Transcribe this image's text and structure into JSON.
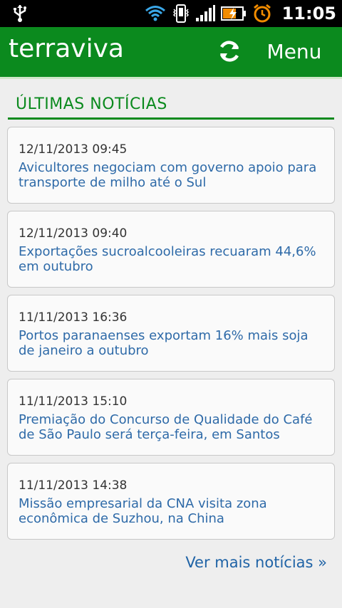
{
  "status_bar": {
    "time": "11:05",
    "icons": [
      "usb-icon",
      "wifi-icon",
      "vibrate-icon",
      "signal-icon",
      "battery-charging-icon",
      "alarm-icon"
    ]
  },
  "app_bar": {
    "logo": "terraviva",
    "menu_label": "Menu",
    "accent_color": "#0b8a1e"
  },
  "section": {
    "title": "ÚLTIMAS NOTÍCIAS"
  },
  "news": [
    {
      "date": "12/11/2013 09:45",
      "title": "Avicultores negociam com governo apoio para transporte de milho até o Sul"
    },
    {
      "date": "12/11/2013 09:40",
      "title": "Exportações sucroalcooleiras recuaram 44,6% em outubro"
    },
    {
      "date": "11/11/2013 16:36",
      "title": "Portos paranaenses exportam 16% mais soja de janeiro a outubro"
    },
    {
      "date": "11/11/2013 15:10",
      "title": "Premiação do Concurso de Qualidade do Café de São Paulo será terça-feira, em Santos"
    },
    {
      "date": "11/11/2013 14:38",
      "title": "Missão empresarial da CNA visita zona econômica de Suzhou, na China"
    }
  ],
  "more_link": "Ver mais notícias »"
}
